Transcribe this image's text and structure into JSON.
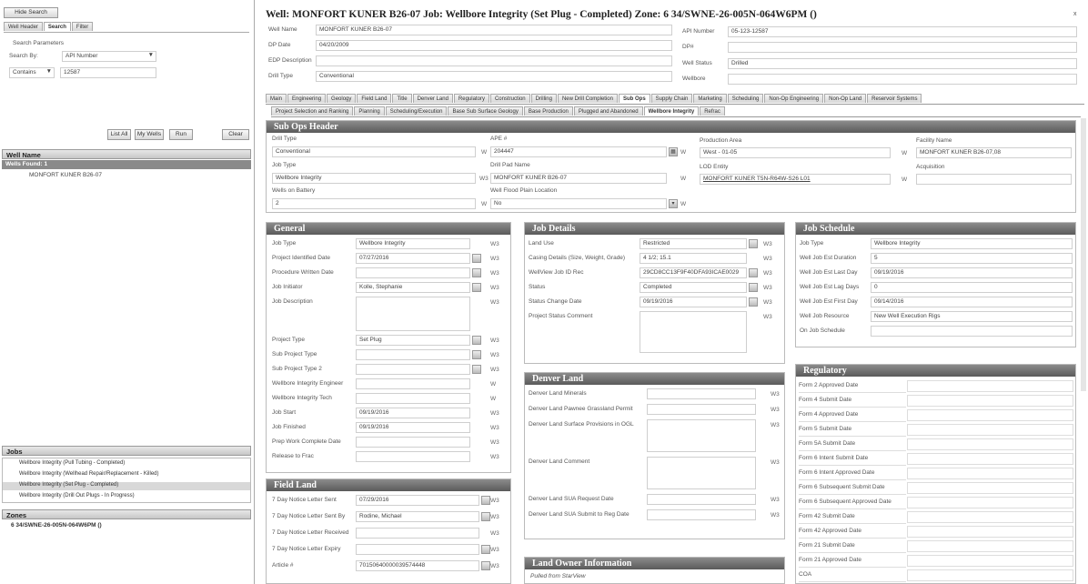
{
  "left": {
    "hide_search": "Hide Search",
    "tabs": [
      "Well Header",
      "Search",
      "Filter"
    ],
    "search_params_label": "Search Parameters",
    "search_by_label": "Search By:",
    "search_by_value": "API Number",
    "operator_value": "Contains",
    "search_value": "12587",
    "buttons": [
      "List All",
      "My Wells",
      "Run",
      "Clear"
    ],
    "well_name_header": "Well Name",
    "wells_found": "Wells Found: 1",
    "well_item": "MONFORT KUNER B26-07",
    "jobs_header": "Jobs",
    "jobs": [
      "Wellbore Integrity (Pull Tubing - Completed)",
      "Wellbore Integrity (Wellhead Repair/Replacement - Killed)",
      "Wellbore Integrity (Set Plug - Completed)",
      "Wellbore Integrity (Drill Out Plugs - In Progress)"
    ],
    "zones_header": "Zones",
    "zone_item": "6  34/SWNE-26-005N-064W6PM ()"
  },
  "header": {
    "title": "Well: MONFORT KUNER B26-07   Job: Wellbore Integrity (Set Plug - Completed)   Zone: 6   34/SWNE-26-005N-064W6PM ()",
    "fields": [
      {
        "label": "Well Name",
        "value": "MONFORT KUNER B26-07"
      },
      {
        "label": "DP Date",
        "value": "04/20/2009"
      },
      {
        "label": "EDP Description",
        "value": ""
      },
      {
        "label": "Drill Type",
        "value": "Conventional"
      }
    ],
    "right_fields": [
      {
        "label": "API Number",
        "value": "05-123-12587"
      },
      {
        "label": "DP#",
        "value": ""
      },
      {
        "label": "Well Status",
        "value": "Drilled"
      },
      {
        "label": "Wellbore",
        "value": ""
      }
    ]
  },
  "main_tabs": [
    "Main",
    "Engineering",
    "Geology",
    "Field Land",
    "Title",
    "Denver Land",
    "Regulatory",
    "Construction",
    "Drilling",
    "New Drill Completion",
    "Sub Ops",
    "Supply Chain",
    "Marketing",
    "Scheduling",
    "Non-Op Engineering",
    "Non-Op Land",
    "Reservoir Systems"
  ],
  "sub_tabs": [
    "Project Selection and Ranking",
    "Planning",
    "Scheduling/Execution",
    "Base Sub Surface Geology",
    "Base Production",
    "Plugged and Abandoned",
    "Wellbore Integrity",
    "Refrac"
  ],
  "sub_ops_header": {
    "title": "Sub Ops Header",
    "fields": [
      {
        "label": "Drill Type",
        "value": "Conventional",
        "w": "W"
      },
      {
        "label": "APE #",
        "value": "204447",
        "w": "W"
      },
      {
        "label": "Production Area",
        "value": "West - 01-05",
        "w": "W"
      },
      {
        "label": "Facility Name",
        "value": "MONFORT KUNER B26-07,08"
      },
      {
        "label": "Job Type",
        "value": "Wellbore Integrity",
        "w": "W3"
      },
      {
        "label": "Drill Pad Name",
        "value": "MONFORT KUNER B26-07",
        "w": "W"
      },
      {
        "label": "LOD Entity",
        "value": "MONFORT KUNER T5N-R64W-S26 L01",
        "w": "W"
      },
      {
        "label": "Acquisition",
        "value": ""
      },
      {
        "label": "Wells on Battery",
        "value": "2",
        "w": "W"
      },
      {
        "label": "Well Flood Plain Location",
        "value": "No",
        "w": "W"
      }
    ]
  },
  "general": {
    "title": "General",
    "fields": [
      {
        "label": "Job Type",
        "value": "Wellbore Integrity",
        "w": "W3"
      },
      {
        "label": "Project Identified Date",
        "value": "07/27/2016",
        "w": "W3"
      },
      {
        "label": "Procedure Written Date",
        "value": "",
        "w": "W3"
      },
      {
        "label": "Job Initiator",
        "value": "Kolle, Stephanie",
        "w": "W3"
      },
      {
        "label": "Job Description",
        "value": "",
        "w": "W3"
      },
      {
        "label": "Project Type",
        "value": "Set Plug",
        "w": "W3"
      },
      {
        "label": "Sub Project Type",
        "value": "",
        "w": "W3"
      },
      {
        "label": "Sub Project Type 2",
        "value": "",
        "w": "W3"
      },
      {
        "label": "Wellbore Integrity Engineer",
        "value": "",
        "w": "W"
      },
      {
        "label": "Wellbore Integrity Tech",
        "value": "",
        "w": "W"
      },
      {
        "label": "Job Start",
        "value": "09/19/2016",
        "w": "W3"
      },
      {
        "label": "Job Finished",
        "value": "09/19/2016",
        "w": "W3"
      },
      {
        "label": "Prep Work Complete Date",
        "value": "",
        "w": "W3"
      },
      {
        "label": "Release to Frac",
        "value": "",
        "w": "W3"
      }
    ]
  },
  "field_land": {
    "title": "Field Land",
    "fields": [
      {
        "label": "7 Day Notice Letter Sent",
        "value": "07/29/2016",
        "w": "W3"
      },
      {
        "label": "7 Day Notice Letter Sent By",
        "value": "Rodine, Michael",
        "w": "W3"
      },
      {
        "label": "7 Day Notice Letter Received",
        "value": "",
        "w": "W3"
      },
      {
        "label": "7 Day Notice Letter Expiry",
        "value": "",
        "w": "W3"
      },
      {
        "label": "Article #",
        "value": "70150640000039574448",
        "w": "W3"
      }
    ]
  },
  "job_details": {
    "title": "Job Details",
    "fields": [
      {
        "label": "Land Use",
        "value": "Restricted",
        "w": "W3"
      },
      {
        "label": "Casing Details (Size, Weight, Grade)",
        "value": "4 1/2; 15.1",
        "w": "W3"
      },
      {
        "label": "WellView Job ID Rec",
        "value": "29CD8CC13F9F40DFA93ICAE0029",
        "w": "W3"
      },
      {
        "label": "Status",
        "value": "Completed",
        "w": "W3"
      },
      {
        "label": "Status Change Date",
        "value": "09/19/2016",
        "w": "W3"
      },
      {
        "label": "Project Status Comment",
        "value": "",
        "w": "W3"
      }
    ]
  },
  "denver_land": {
    "title": "Denver Land",
    "fields": [
      {
        "label": "Denver Land Minerals",
        "value": "",
        "w": "W3"
      },
      {
        "label": "Denver Land Pawnee Grassland Permit",
        "value": "",
        "w": "W3"
      },
      {
        "label": "Denver Land Surface Provisions in OGL",
        "value": "",
        "w": "W3"
      },
      {
        "label": "Denver Land Comment",
        "value": "",
        "w": "W3"
      },
      {
        "label": "Denver Land SUA Request Date",
        "value": "",
        "w": "W3"
      },
      {
        "label": "Denver Land SUA Submit to Reg Date",
        "value": "",
        "w": "W3"
      }
    ]
  },
  "land_owner": {
    "title": "Land Owner Information",
    "subtitle": "Pulled from StarView"
  },
  "job_schedule": {
    "title": "Job Schedule",
    "fields": [
      {
        "label": "Job Type",
        "value": "Wellbore Integrity"
      },
      {
        "label": "Well Job Est Duration",
        "value": "5"
      },
      {
        "label": "Well Job Est Last Day",
        "value": "09/19/2016"
      },
      {
        "label": "Well Job Est Lag Days",
        "value": "0"
      },
      {
        "label": "Well Job Est First Day",
        "value": "09/14/2016"
      },
      {
        "label": "Well Job Resource",
        "value": "New Well Execution Rigs"
      },
      {
        "label": "On Job Schedule",
        "value": ""
      }
    ]
  },
  "regulatory": {
    "title": "Regulatory",
    "fields": [
      "Form 2 Approved Date",
      "Form 4 Submit Date",
      "Form 4 Approved Date",
      "Form 5 Submit Date",
      "Form 5A Submit Date",
      "Form 6 Intent Submit Date",
      "Form 6 Intent Approved Date",
      "Form 6 Subsequent Submit Date",
      "Form 6 Subsequent Approved Date",
      "Form 42 Submit Date",
      "Form 42 Approved Date",
      "Form 21 Submit Date",
      "Form 21 Approved Date",
      "COA"
    ]
  }
}
